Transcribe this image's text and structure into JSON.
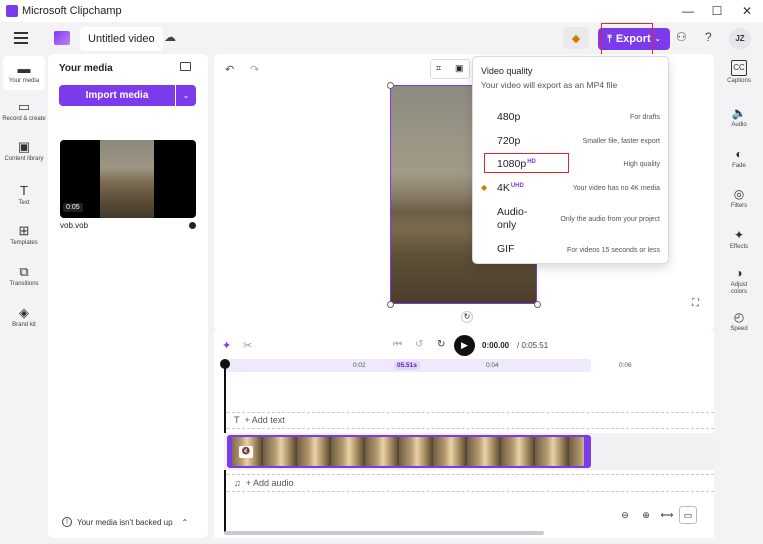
{
  "window": {
    "title": "Microsoft Clipchamp",
    "minimize": "—",
    "maximize": "☐",
    "close": "✕"
  },
  "header": {
    "project_title": "Untitled video",
    "export_label": "Export",
    "avatar": "JZ",
    "help": "?"
  },
  "left_nav": {
    "items": [
      {
        "label": "Your media",
        "icon": "folder-icon",
        "glyph": "▬"
      },
      {
        "label": "Record & create",
        "icon": "camera-icon",
        "glyph": "▭"
      },
      {
        "label": "Content library",
        "icon": "library-icon",
        "glyph": "▣"
      },
      {
        "label": "Text",
        "icon": "text-icon",
        "glyph": "T"
      },
      {
        "label": "Templates",
        "icon": "templates-icon",
        "glyph": "⊞"
      },
      {
        "label": "Transitions",
        "icon": "transitions-icon",
        "glyph": "⧉"
      },
      {
        "label": "Brand kit",
        "icon": "brand-kit-icon",
        "glyph": "◈"
      }
    ]
  },
  "media_panel": {
    "title": "Your media",
    "import_label": "Import media",
    "clip_duration": "0:05",
    "clip_name": "vob.vob",
    "backup_text": "Your media isn't backed up"
  },
  "export_menu": {
    "title": "Video quality",
    "subtitle": "Your video will export as an MP4 file",
    "options": [
      {
        "label": "480p",
        "badge": "",
        "desc": "For drafts"
      },
      {
        "label": "720p",
        "badge": "",
        "desc": "Smaller file, faster export"
      },
      {
        "label": "1080p",
        "badge": "HD",
        "desc": "High quality"
      },
      {
        "label": "4K",
        "badge": "UHD",
        "desc": "Your video has no 4K media"
      },
      {
        "label": "Audio-only",
        "badge": "",
        "desc": "Only the audio from your project"
      },
      {
        "label": "GIF",
        "badge": "",
        "desc": "For videos 15 seconds or less"
      }
    ]
  },
  "timeline": {
    "current_time": "0:00.00",
    "total_time": "/ 0:05.51",
    "ruler": [
      "0:02",
      "05.51s",
      "0:04",
      "0:06"
    ],
    "add_text": "+ Add text",
    "add_audio": "+ Add audio"
  },
  "right_panel": {
    "items": [
      {
        "label": "Captions",
        "icon": "captions-icon",
        "glyph": "CC"
      },
      {
        "label": "Audio",
        "icon": "speaker-icon",
        "glyph": "🔈"
      },
      {
        "label": "Fade",
        "icon": "fade-icon",
        "glyph": "◐"
      },
      {
        "label": "Filters",
        "icon": "filters-icon",
        "glyph": "◎"
      },
      {
        "label": "Effects",
        "icon": "effects-icon",
        "glyph": "✦"
      },
      {
        "label": "Adjust colors",
        "icon": "adjust-colors-icon",
        "glyph": "◑"
      },
      {
        "label": "Speed",
        "icon": "speed-icon",
        "glyph": "◴"
      }
    ]
  },
  "colors": {
    "accent": "#7c3aed",
    "highlight_box": "#e0282e"
  }
}
